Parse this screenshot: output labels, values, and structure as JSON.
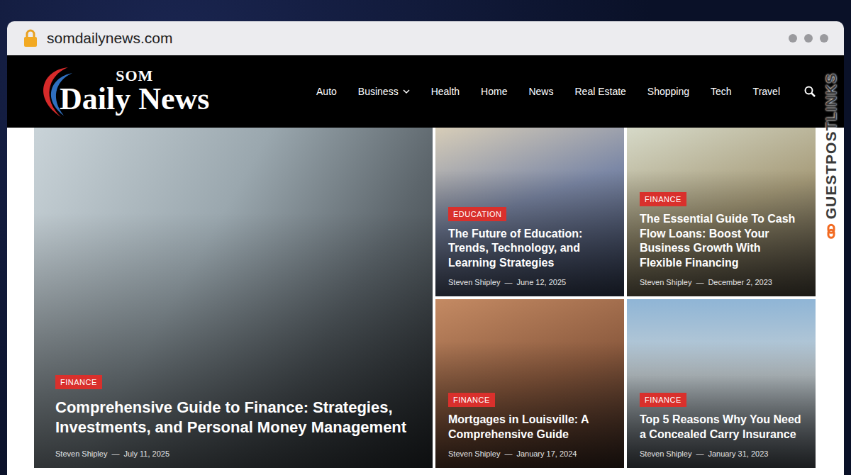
{
  "browser": {
    "url": "somdailynews.com"
  },
  "logo": {
    "top": "SOM",
    "main": "Daily News"
  },
  "nav": [
    {
      "label": "Auto",
      "has_dropdown": false
    },
    {
      "label": "Business",
      "has_dropdown": true
    },
    {
      "label": "Health",
      "has_dropdown": false
    },
    {
      "label": "Home",
      "has_dropdown": false
    },
    {
      "label": "News",
      "has_dropdown": false
    },
    {
      "label": "Real Estate",
      "has_dropdown": false
    },
    {
      "label": "Shopping",
      "has_dropdown": false
    },
    {
      "label": "Tech",
      "has_dropdown": false
    },
    {
      "label": "Travel",
      "has_dropdown": false
    }
  ],
  "posts": [
    {
      "kind": "featured",
      "category": "FINANCE",
      "title": "Comprehensive Guide to Finance: Strategies, Investments, and Personal Money Management",
      "author": "Steven Shipley",
      "separator": "—",
      "date": "July 11, 2025"
    },
    {
      "kind": "card",
      "category": "EDUCATION",
      "title": "The Future of Education: Trends, Technology, and Learning Strategies",
      "author": "Steven Shipley",
      "separator": "—",
      "date": "June 12, 2025"
    },
    {
      "kind": "card",
      "category": "FINANCE",
      "title": "The Essential Guide To Cash Flow Loans: Boost Your Business Growth With Flexible Financing",
      "author": "Steven Shipley",
      "separator": "—",
      "date": "December 2, 2023"
    },
    {
      "kind": "card",
      "category": "FINANCE",
      "title": "Mortgages in Louisville: A Comprehensive Guide",
      "author": "Steven Shipley",
      "separator": "—",
      "date": "January 17, 2024"
    },
    {
      "kind": "card",
      "category": "FINANCE",
      "title": "Top 5 Reasons Why You Need a Concealed Carry Insurance",
      "author": "Steven Shipley",
      "separator": "—",
      "date": "January 31, 2023"
    }
  ],
  "watermark": "GUESTPOSTLINKS"
}
